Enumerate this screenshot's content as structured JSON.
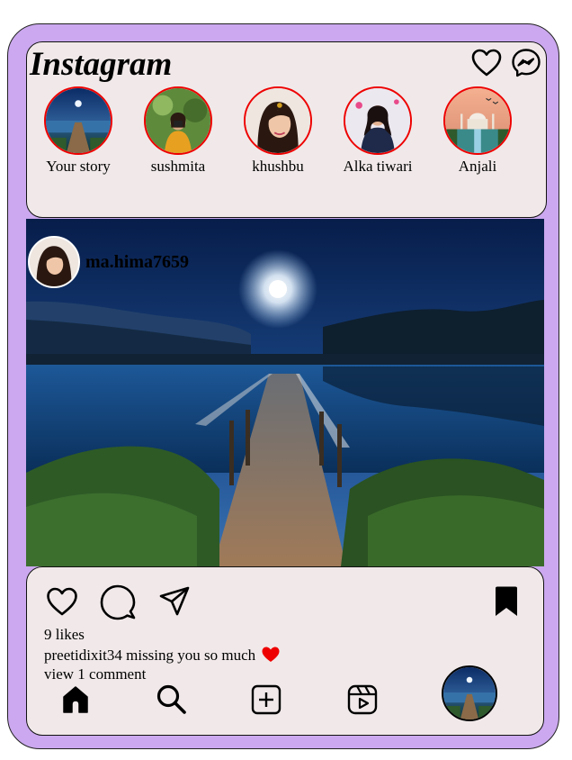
{
  "app": {
    "brand": "Instagram"
  },
  "header": {
    "icons": [
      "heart-icon",
      "messenger-icon"
    ]
  },
  "stories": [
    {
      "name": "Your story"
    },
    {
      "name": "sushmita"
    },
    {
      "name": "khushbu"
    },
    {
      "name": "Alka tiwari"
    },
    {
      "name": "Anjali"
    }
  ],
  "post": {
    "username": "ma.hima7659",
    "likes": "9 likes",
    "caption_user": "preetidixit34",
    "caption_text": "missing you so much",
    "view_comments": "view 1 comment"
  },
  "actions": [
    "like-icon",
    "comment-icon",
    "share-icon",
    "bookmark-icon"
  ],
  "nav": [
    "home-icon",
    "search-icon",
    "create-icon",
    "reels-icon",
    "profile-avatar"
  ],
  "colors": {
    "frame": "#cba8ef",
    "card": "#f1e9e9",
    "story_ring": "#ee0000",
    "heart": "#ee0000"
  }
}
